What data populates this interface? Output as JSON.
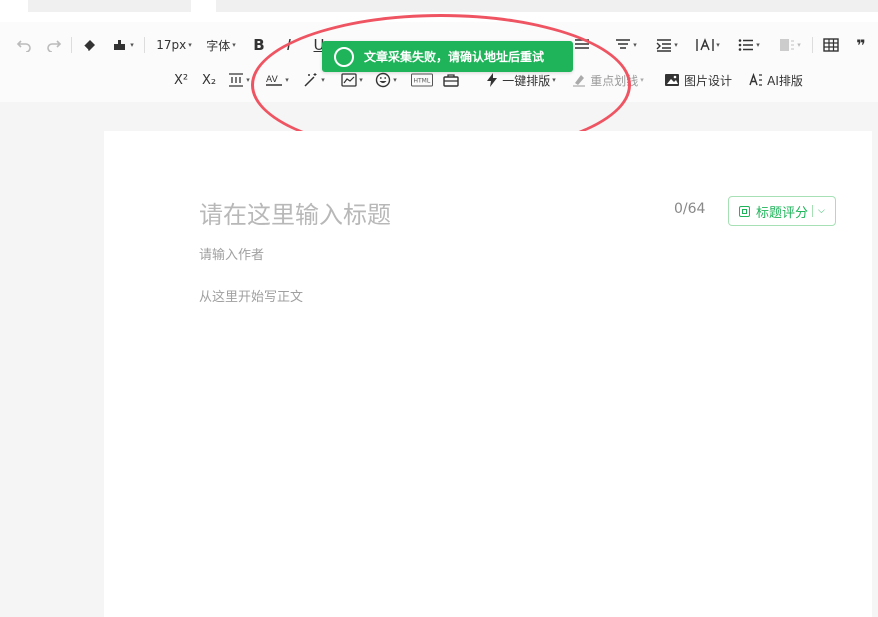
{
  "toolbar": {
    "font_size": "17px",
    "font_family": "字体",
    "one_click_layout": "一键排版",
    "highlight_sentence": "重点划线",
    "image_design": "图片设计",
    "ai_layout": "AI排版",
    "superscript": "X²",
    "subscript": "X₂",
    "bold": "B",
    "italic": "I",
    "underline": "U",
    "html_label": "HTML",
    "quote": "❞"
  },
  "toast": {
    "message": "文章采集失败，请确认地址后重试",
    "color": "#1fb45a"
  },
  "annotation": {
    "color": "#ef5462"
  },
  "editor": {
    "title_placeholder": "请在这里输入标题",
    "title_counter": "0/64",
    "title_score_button": "标题评分",
    "author_placeholder": "请输入作者",
    "body_placeholder": "从这里开始写正文"
  }
}
